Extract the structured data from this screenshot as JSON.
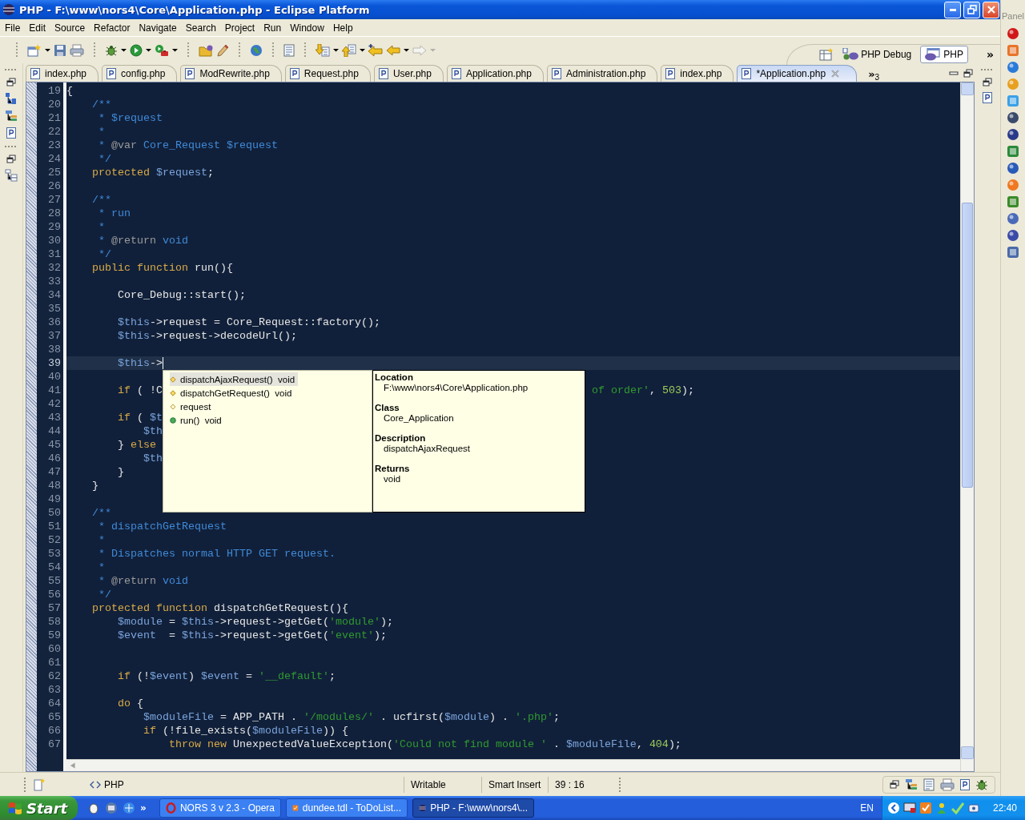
{
  "window": {
    "title": "PHP - F:\\www\\nors4\\Core\\Application.php - Eclipse Platform"
  },
  "menu": [
    "File",
    "Edit",
    "Source",
    "Refactor",
    "Navigate",
    "Search",
    "Project",
    "Run",
    "Window",
    "Help"
  ],
  "perspectives": [
    {
      "label": "PHP Debug",
      "selected": false
    },
    {
      "label": "PHP",
      "selected": true
    }
  ],
  "perspective_more": "»",
  "editor_tabs": [
    {
      "label": "index.php",
      "selected": false
    },
    {
      "label": "config.php",
      "selected": false
    },
    {
      "label": "ModRewrite.php",
      "selected": false
    },
    {
      "label": "Request.php",
      "selected": false
    },
    {
      "label": "User.php",
      "selected": false
    },
    {
      "label": "Application.php",
      "selected": false
    },
    {
      "label": "Administration.php",
      "selected": false
    },
    {
      "label": "index.php",
      "selected": false
    },
    {
      "label": "*Application.php",
      "selected": true
    }
  ],
  "tabs_overflow": {
    "glyph": "»",
    "count": "3"
  },
  "editor": {
    "lines": [
      {
        "number": "19",
        "current": false,
        "tokens": [
          {
            "kind": "plain",
            "text": "{"
          }
        ]
      },
      {
        "number": "20",
        "current": false,
        "tokens": [
          {
            "kind": "comment",
            "text": "    /**"
          }
        ]
      },
      {
        "number": "21",
        "current": false,
        "tokens": [
          {
            "kind": "comment",
            "text": "     * $request"
          }
        ]
      },
      {
        "number": "22",
        "current": false,
        "tokens": [
          {
            "kind": "comment",
            "text": "     *"
          }
        ]
      },
      {
        "number": "23",
        "current": false,
        "tokens": [
          {
            "kind": "comment",
            "text": "     * "
          },
          {
            "kind": "doctag",
            "text": "@var"
          },
          {
            "kind": "comment",
            "text": " Core_Request $request"
          }
        ]
      },
      {
        "number": "24",
        "current": false,
        "tokens": [
          {
            "kind": "comment",
            "text": "     */"
          }
        ]
      },
      {
        "number": "25",
        "current": false,
        "tokens": [
          {
            "kind": "keyword",
            "text": "    protected"
          },
          {
            "kind": "variable",
            "text": " $request"
          },
          {
            "kind": "plain",
            "text": ";"
          }
        ]
      },
      {
        "number": "26",
        "current": false
      },
      {
        "number": "27",
        "current": false,
        "tokens": [
          {
            "kind": "comment",
            "text": "    /**"
          }
        ]
      },
      {
        "number": "28",
        "current": false,
        "tokens": [
          {
            "kind": "comment",
            "text": "     * run"
          }
        ]
      },
      {
        "number": "29",
        "current": false,
        "tokens": [
          {
            "kind": "comment",
            "text": "     *"
          }
        ]
      },
      {
        "number": "30",
        "current": false,
        "tokens": [
          {
            "kind": "comment",
            "text": "     * "
          },
          {
            "kind": "doctag",
            "text": "@return"
          },
          {
            "kind": "comment",
            "text": " void"
          }
        ]
      },
      {
        "number": "31",
        "current": false,
        "tokens": [
          {
            "kind": "comment",
            "text": "     */"
          }
        ]
      },
      {
        "number": "32",
        "current": false,
        "tokens": [
          {
            "kind": "keyword",
            "text": "    public function"
          },
          {
            "kind": "plain",
            "text": " run(){"
          }
        ]
      },
      {
        "number": "33",
        "current": false
      },
      {
        "number": "34",
        "current": false,
        "tokens": [
          {
            "kind": "plain",
            "text": "        Core_Debug::start();"
          }
        ]
      },
      {
        "number": "35",
        "current": false
      },
      {
        "number": "36",
        "current": false,
        "tokens": [
          {
            "kind": "variable",
            "text": "        $this"
          },
          {
            "kind": "plain",
            "text": "->request = Core_Request::factory();"
          }
        ]
      },
      {
        "number": "37",
        "current": false,
        "tokens": [
          {
            "kind": "variable",
            "text": "        $this"
          },
          {
            "kind": "plain",
            "text": "->request->decodeUrl();"
          }
        ]
      },
      {
        "number": "38",
        "current": false
      },
      {
        "number": "39",
        "current": true,
        "tokens": [
          {
            "kind": "variable",
            "text": "        $this"
          },
          {
            "kind": "plain",
            "text": "->"
          }
        ]
      },
      {
        "number": "40",
        "current": false
      },
      {
        "number": "41",
        "current": false,
        "tokens": [
          {
            "kind": "keyword",
            "text": "        if"
          },
          {
            "kind": "plain",
            "text": " ( !C"
          }
        ],
        "tail": [
          {
            "kind": "string",
            "text": "of order'"
          },
          {
            "kind": "plain",
            "text": ", "
          },
          {
            "kind": "number",
            "text": "503"
          },
          {
            "kind": "plain",
            "text": ");"
          }
        ]
      },
      {
        "number": "42",
        "current": false
      },
      {
        "number": "43",
        "current": false,
        "tokens": [
          {
            "kind": "keyword",
            "text": "        if"
          },
          {
            "kind": "plain",
            "text": " ( "
          },
          {
            "kind": "variable",
            "text": "$t"
          }
        ]
      },
      {
        "number": "44",
        "current": false,
        "tokens": [
          {
            "kind": "variable",
            "text": "            $th"
          }
        ]
      },
      {
        "number": "45",
        "current": false,
        "tokens": [
          {
            "kind": "plain",
            "text": "        } "
          },
          {
            "kind": "keyword",
            "text": "else"
          }
        ]
      },
      {
        "number": "46",
        "current": false,
        "tokens": [
          {
            "kind": "variable",
            "text": "            $th"
          }
        ]
      },
      {
        "number": "47",
        "current": false,
        "tokens": [
          {
            "kind": "plain",
            "text": "        }"
          }
        ]
      },
      {
        "number": "48",
        "current": false,
        "tokens": [
          {
            "kind": "plain",
            "text": "    }"
          }
        ]
      },
      {
        "number": "49",
        "current": false
      },
      {
        "number": "50",
        "current": false,
        "tokens": [
          {
            "kind": "comment",
            "text": "    /**"
          }
        ]
      },
      {
        "number": "51",
        "current": false,
        "tokens": [
          {
            "kind": "comment",
            "text": "     * dispatchGetRequest"
          }
        ]
      },
      {
        "number": "52",
        "current": false,
        "tokens": [
          {
            "kind": "comment",
            "text": "     *"
          }
        ]
      },
      {
        "number": "53",
        "current": false,
        "tokens": [
          {
            "kind": "comment",
            "text": "     * Dispatches normal HTTP GET request."
          }
        ]
      },
      {
        "number": "54",
        "current": false,
        "tokens": [
          {
            "kind": "comment",
            "text": "     *"
          }
        ]
      },
      {
        "number": "55",
        "current": false,
        "tokens": [
          {
            "kind": "comment",
            "text": "     * "
          },
          {
            "kind": "doctag",
            "text": "@return"
          },
          {
            "kind": "comment",
            "text": " void"
          }
        ]
      },
      {
        "number": "56",
        "current": false,
        "tokens": [
          {
            "kind": "comment",
            "text": "     */"
          }
        ]
      },
      {
        "number": "57",
        "current": false,
        "tokens": [
          {
            "kind": "keyword",
            "text": "    protected function"
          },
          {
            "kind": "plain",
            "text": " dispatchGetRequest(){"
          }
        ]
      },
      {
        "number": "58",
        "current": false,
        "tokens": [
          {
            "kind": "variable",
            "text": "        $module"
          },
          {
            "kind": "plain",
            "text": " = "
          },
          {
            "kind": "variable",
            "text": "$this"
          },
          {
            "kind": "plain",
            "text": "->request->getGet("
          },
          {
            "kind": "string",
            "text": "'module'"
          },
          {
            "kind": "plain",
            "text": ");"
          }
        ]
      },
      {
        "number": "59",
        "current": false,
        "tokens": [
          {
            "kind": "variable",
            "text": "        $event"
          },
          {
            "kind": "plain",
            "text": "  = "
          },
          {
            "kind": "variable",
            "text": "$this"
          },
          {
            "kind": "plain",
            "text": "->request->getGet("
          },
          {
            "kind": "string",
            "text": "'event'"
          },
          {
            "kind": "plain",
            "text": ");"
          }
        ]
      },
      {
        "number": "60",
        "current": false
      },
      {
        "number": "61",
        "current": false
      },
      {
        "number": "62",
        "current": false,
        "tokens": [
          {
            "kind": "keyword",
            "text": "        if"
          },
          {
            "kind": "plain",
            "text": " (!"
          },
          {
            "kind": "variable",
            "text": "$event"
          },
          {
            "kind": "plain",
            "text": ") "
          },
          {
            "kind": "variable",
            "text": "$event"
          },
          {
            "kind": "plain",
            "text": " = "
          },
          {
            "kind": "string",
            "text": "'__default'"
          },
          {
            "kind": "plain",
            "text": ";"
          }
        ]
      },
      {
        "number": "63",
        "current": false
      },
      {
        "number": "64",
        "current": false,
        "tokens": [
          {
            "kind": "keyword",
            "text": "        do"
          },
          {
            "kind": "plain",
            "text": " {"
          }
        ]
      },
      {
        "number": "65",
        "current": false,
        "tokens": [
          {
            "kind": "variable",
            "text": "            $moduleFile"
          },
          {
            "kind": "plain",
            "text": " = APP_PATH . "
          },
          {
            "kind": "string",
            "text": "'/modules/'"
          },
          {
            "kind": "plain",
            "text": " . ucfirst("
          },
          {
            "kind": "variable",
            "text": "$module"
          },
          {
            "kind": "plain",
            "text": ") . "
          },
          {
            "kind": "string",
            "text": "'.php'"
          },
          {
            "kind": "plain",
            "text": ";"
          }
        ]
      },
      {
        "number": "66",
        "current": false,
        "tokens": [
          {
            "kind": "keyword",
            "text": "            if"
          },
          {
            "kind": "plain",
            "text": " (!file_exists("
          },
          {
            "kind": "variable",
            "text": "$moduleFile"
          },
          {
            "kind": "plain",
            "text": ")) {"
          }
        ]
      },
      {
        "number": "67",
        "current": false,
        "tokens": [
          {
            "kind": "keyword",
            "text": "                throw new"
          },
          {
            "kind": "plain",
            "text": " UnexpectedValueException("
          },
          {
            "kind": "string",
            "text": "'Could not find module '"
          },
          {
            "kind": "plain",
            "text": " . "
          },
          {
            "kind": "variable",
            "text": "$moduleFile"
          },
          {
            "kind": "plain",
            "text": ", "
          },
          {
            "kind": "number",
            "text": "404"
          },
          {
            "kind": "plain",
            "text": ");"
          }
        ]
      }
    ]
  },
  "completion": {
    "items": [
      {
        "kind": "method",
        "label": "dispatchAjaxRequest()",
        "type": "void",
        "selected": true
      },
      {
        "kind": "method",
        "label": "dispatchGetRequest()",
        "type": "void",
        "selected": false
      },
      {
        "kind": "field",
        "label": "request",
        "selected": false
      },
      {
        "kind": "public_method",
        "label": "run()",
        "type": "void",
        "selected": false
      }
    ],
    "doc": [
      {
        "heading": "Location",
        "text": "F:\\www\\nors4\\Core\\Application.php"
      },
      {
        "heading": "Class",
        "text": "Core_Application"
      },
      {
        "heading": "Description",
        "text": "dispatchAjaxRequest"
      },
      {
        "heading": "Returns",
        "text": "void"
      }
    ]
  },
  "status_bar": {
    "language": "PHP",
    "mode": "Writable",
    "insert": "Smart Insert",
    "position": "39 : 16"
  },
  "side_panel": {
    "title": "Panel"
  },
  "taskbar": {
    "start": "Start",
    "quick_launch_more": "»",
    "tasks": [
      {
        "label": "NORS 3 v 2.3 - Opera",
        "selected": false
      },
      {
        "label": "dundee.tdl - ToDoList...",
        "selected": false
      },
      {
        "label": "PHP - F:\\www\\nors4\\...",
        "selected": true
      }
    ],
    "language": "EN",
    "clock": "22:40"
  }
}
